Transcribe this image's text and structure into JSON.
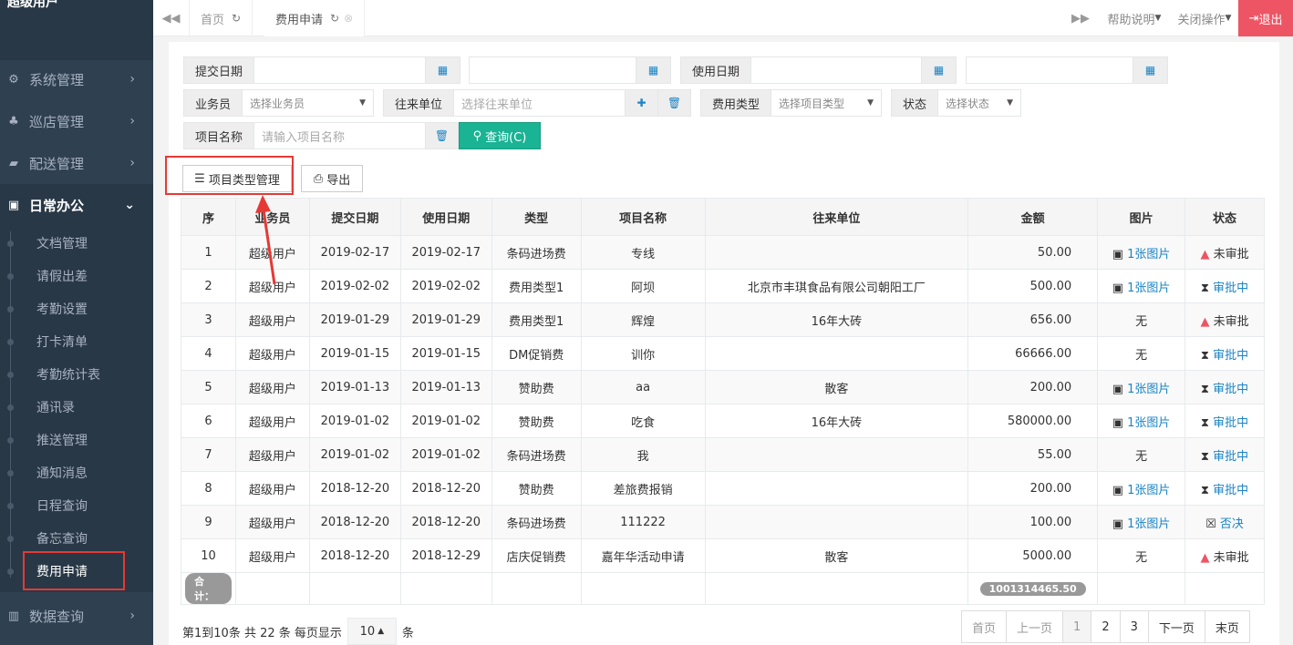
{
  "sidebar": {
    "user": "超级用户",
    "menus": [
      {
        "label": "系统管理",
        "icon": "gears-icon"
      },
      {
        "label": "巡店管理",
        "icon": "sitemap-icon"
      },
      {
        "label": "配送管理",
        "icon": "truck-icon"
      },
      {
        "label": "日常办公",
        "icon": "briefcase-icon"
      },
      {
        "label": "数据查询",
        "icon": "bar-chart-icon"
      }
    ],
    "submenu": [
      "文档管理",
      "请假出差",
      "考勤设置",
      "打卡清单",
      "考勤统计表",
      "通讯录",
      "推送管理",
      "通知消息",
      "日程查询",
      "备忘查询",
      "费用申请"
    ]
  },
  "topbar": {
    "tabs": [
      "首页",
      "费用申请"
    ],
    "help": "帮助说明",
    "close_ops": "关闭操作",
    "exit": "退出"
  },
  "filters": {
    "submit_date": "提交日期",
    "use_date": "使用日期",
    "salesman": "业务员",
    "salesman_placeholder": "选择业务员",
    "partner": "往来单位",
    "partner_placeholder": "选择往来单位",
    "fee_type": "费用类型",
    "fee_type_placeholder": "选择项目类型",
    "status": "状态",
    "status_placeholder": "选择状态",
    "project_name": "项目名称",
    "project_placeholder": "请输入项目名称",
    "query": "查询(C)"
  },
  "toolbar": {
    "type_manage": "项目类型管理",
    "export": "导出"
  },
  "table": {
    "headers": [
      "序",
      "业务员",
      "提交日期",
      "使用日期",
      "类型",
      "项目名称",
      "往来单位",
      "金额",
      "图片",
      "状态"
    ],
    "rows": [
      [
        "1",
        "超级用户",
        "2019-02-17",
        "2019-02-17",
        "条码进场费",
        "专线",
        "",
        "50.00",
        "1张图片",
        "未审批"
      ],
      [
        "2",
        "超级用户",
        "2019-02-02",
        "2019-02-02",
        "费用类型1",
        "阿坝",
        "北京市丰琪食品有限公司朝阳工厂",
        "500.00",
        "1张图片",
        "审批中"
      ],
      [
        "3",
        "超级用户",
        "2019-01-29",
        "2019-01-29",
        "费用类型1",
        "辉煌",
        "16年大砖",
        "656.00",
        "无",
        "未审批"
      ],
      [
        "4",
        "超级用户",
        "2019-01-15",
        "2019-01-15",
        "DM促销费",
        "训你",
        "",
        "66666.00",
        "无",
        "审批中"
      ],
      [
        "5",
        "超级用户",
        "2019-01-13",
        "2019-01-13",
        "赞助费",
        "aa",
        "散客",
        "200.00",
        "1张图片",
        "审批中"
      ],
      [
        "6",
        "超级用户",
        "2019-01-02",
        "2019-01-02",
        "赞助费",
        "吃食",
        "16年大砖",
        "580000.00",
        "1张图片",
        "审批中"
      ],
      [
        "7",
        "超级用户",
        "2019-01-02",
        "2019-01-02",
        "条码进场费",
        "我",
        "",
        "55.00",
        "无",
        "审批中"
      ],
      [
        "8",
        "超级用户",
        "2018-12-20",
        "2018-12-20",
        "赞助费",
        "差旅费报销",
        "",
        "200.00",
        "1张图片",
        "审批中"
      ],
      [
        "9",
        "超级用户",
        "2018-12-20",
        "2018-12-20",
        "条码进场费",
        "111222",
        "",
        "100.00",
        "1张图片",
        "否决"
      ],
      [
        "10",
        "超级用户",
        "2018-12-20",
        "2018-12-29",
        "店庆促销费",
        "嘉年华活动申请",
        "散客",
        "5000.00",
        "无",
        "未审批"
      ]
    ],
    "sum_label": "合计：",
    "sum_value": "1001314465.50"
  },
  "pager": {
    "info_prefix": "第1到10条 共 22 条 每页显示",
    "page_size": "10",
    "info_suffix": "条",
    "first": "首页",
    "prev": "上一页",
    "pages": [
      "1",
      "2",
      "3"
    ],
    "next": "下一页",
    "last": "末页"
  },
  "colors": {
    "sidebar": "#2f4050",
    "accent_green": "#1ab394",
    "exit_red": "#ed5565",
    "link_blue": "#1c84c6"
  }
}
